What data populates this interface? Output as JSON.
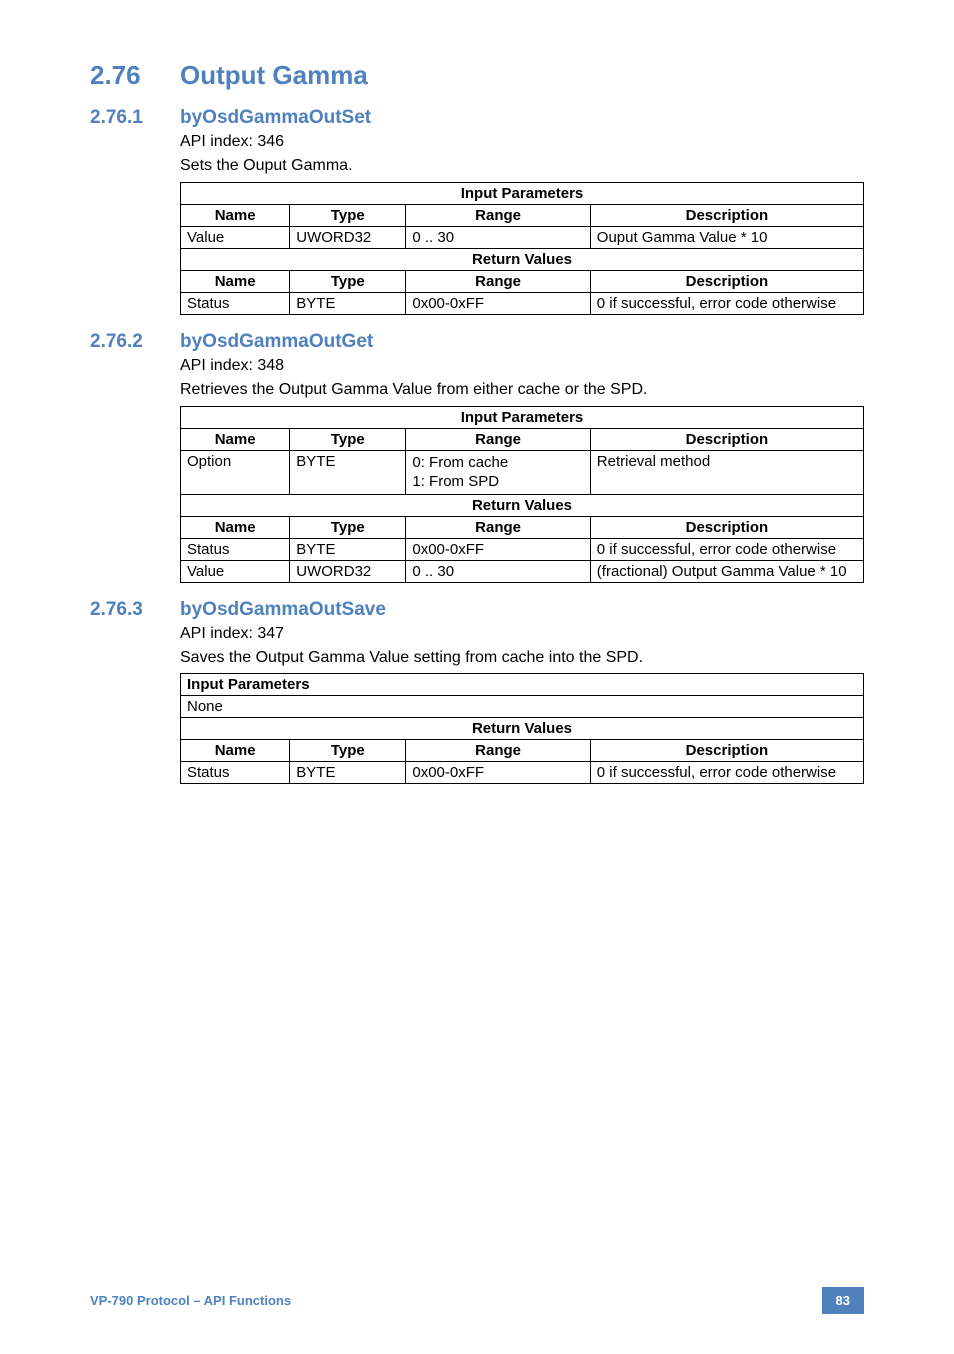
{
  "section": {
    "number": "2.76",
    "title": "Output Gamma"
  },
  "sub1": {
    "number": "2.76.1",
    "title": "byOsdGammaOutSet",
    "api_index": "API index: 346",
    "desc": "Sets the Ouput Gamma.",
    "input_header": "Input Parameters",
    "return_header": "Return Values",
    "cols": {
      "name": "Name",
      "type": "Type",
      "range": "Range",
      "desc": "Description"
    },
    "input_rows": [
      {
        "name": "Value",
        "type": "UWORD32",
        "range": "0 .. 30",
        "desc": "Ouput Gamma Value * 10"
      }
    ],
    "return_rows": [
      {
        "name": "Status",
        "type": "BYTE",
        "range": "0x00-0xFF",
        "desc": "0 if successful, error code otherwise"
      }
    ]
  },
  "sub2": {
    "number": "2.76.2",
    "title": "byOsdGammaOutGet",
    "api_index": "API index: 348",
    "desc": "Retrieves the Output Gamma Value from either cache or the SPD.",
    "input_header": "Input Parameters",
    "return_header": "Return Values",
    "cols": {
      "name": "Name",
      "type": "Type",
      "range": "Range",
      "desc": "Description"
    },
    "input_rows": [
      {
        "name": "Option",
        "type": "BYTE",
        "range_l1": "0: From cache",
        "range_l2": "1: From SPD",
        "desc": "Retrieval method"
      }
    ],
    "return_rows": [
      {
        "name": "Status",
        "type": "BYTE",
        "range": "0x00-0xFF",
        "desc": "0 if successful, error code otherwise"
      },
      {
        "name": "Value",
        "type": "UWORD32",
        "range": "0 .. 30",
        "desc": "(fractional) Output Gamma Value * 10"
      }
    ]
  },
  "sub3": {
    "number": "2.76.3",
    "title": "byOsdGammaOutSave",
    "api_index": "API index: 347",
    "desc": "Saves the Output Gamma Value setting from cache into the SPD.",
    "input_header": "Input Parameters",
    "input_none": "None",
    "return_header": "Return Values",
    "cols": {
      "name": "Name",
      "type": "Type",
      "range": "Range",
      "desc": "Description"
    },
    "return_rows": [
      {
        "name": "Status",
        "type": "BYTE",
        "range": "0x00-0xFF",
        "desc": "0 if successful, error code otherwise"
      }
    ]
  },
  "footer": {
    "left": "VP-790 Protocol –  API Functions",
    "page": "83"
  }
}
